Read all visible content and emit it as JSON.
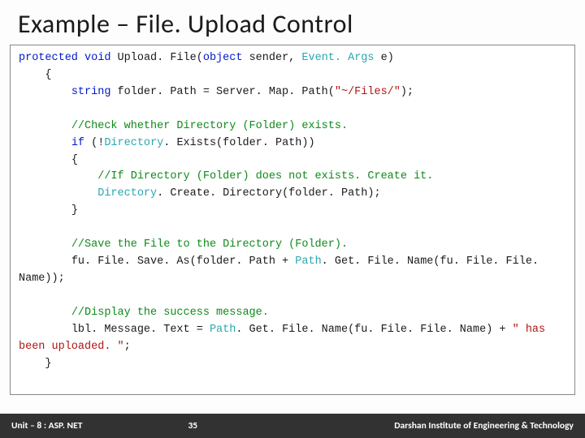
{
  "title": "Example – File. Upload Control",
  "footer": {
    "left": "Unit – 8 : ASP. NET",
    "page": "35",
    "right": "Darshan Institute of Engineering & Technology"
  },
  "code": {
    "line1_a": "protected",
    "line1_b": "void",
    "line1_c": " Upload. File(",
    "line1_d": "object",
    "line1_e": " sender, ",
    "line1_f": "Event. Args",
    "line1_g": " e)",
    "line2": "    {",
    "line3_a": "        ",
    "line3_b": "string",
    "line3_c": " folder. Path = Server. Map. Path(",
    "line3_d": "\"~/Files/\"",
    "line3_e": ");",
    "line5_a": "        ",
    "line5_b": "//Check whether Directory (Folder) exists.",
    "line6_a": "        ",
    "line6_b": "if",
    "line6_c": " (!",
    "line6_d": "Directory",
    "line6_e": ". Exists(folder. Path))",
    "line7": "        {",
    "line8_a": "            ",
    "line8_b": "//If Directory (Folder) does not exists. Create it.",
    "line9_a": "            ",
    "line9_b": "Directory",
    "line9_c": ". Create. Directory(folder. Path);",
    "line10": "        }",
    "line12_a": "        ",
    "line12_b": "//Save the File to the Directory (Folder).",
    "line13_a": "        fu. File. Save. As(folder. Path + ",
    "line13_b": "Path",
    "line13_c": ". Get. File. Name(fu. File. File. Name));",
    "line15_a": "        ",
    "line15_b": "//Display the success message.",
    "line16_a": "        lbl. Message. Text = ",
    "line16_b": "Path",
    "line16_c": ". Get. File. Name(fu. File. File. Name) + ",
    "line16_d": "\" has been uploaded. \"",
    "line16_e": ";",
    "line17": "    }"
  }
}
